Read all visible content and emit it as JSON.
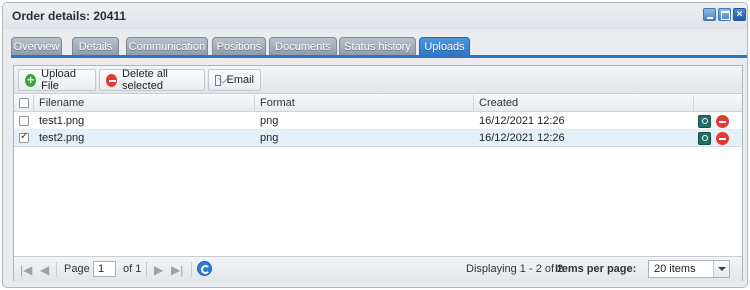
{
  "window": {
    "title": "Order details: 20411"
  },
  "tabs": [
    {
      "label": "Overview"
    },
    {
      "label": "Details"
    },
    {
      "label": "Communication"
    },
    {
      "label": "Positions"
    },
    {
      "label": "Documents"
    },
    {
      "label": "Status history"
    },
    {
      "label": "Uploads",
      "active": true
    }
  ],
  "toolbar": {
    "upload_label": "Upload File",
    "delete_label": "Delete all selected",
    "email_label": "Email"
  },
  "grid": {
    "columns": [
      "Filename",
      "Format",
      "Created"
    ],
    "rows": [
      {
        "filename": "test1.png",
        "format": "png",
        "created": "16/12/2021 12:26",
        "checked": false
      },
      {
        "filename": "test2.png",
        "format": "png",
        "created": "16/12/2021 12:26",
        "checked": true
      }
    ]
  },
  "pager": {
    "page_label": "Page",
    "page_value": "1",
    "of_label": "of 1",
    "display_text": "Displaying 1 - 2 of 2",
    "items_per_page_label": "Items per page:",
    "items_per_page_value": "20 items"
  },
  "colors": {
    "accent": "#2d76c6",
    "selected_row": "#e3eff9",
    "add": "#3ea33d",
    "delete": "#dd3b33"
  },
  "icons": {
    "upload": "plus-circle-icon",
    "delete": "minus-circle-icon",
    "email": "envelope-icon",
    "row_download": "download-icon",
    "row_remove": "remove-icon",
    "refresh": "refresh-icon"
  }
}
